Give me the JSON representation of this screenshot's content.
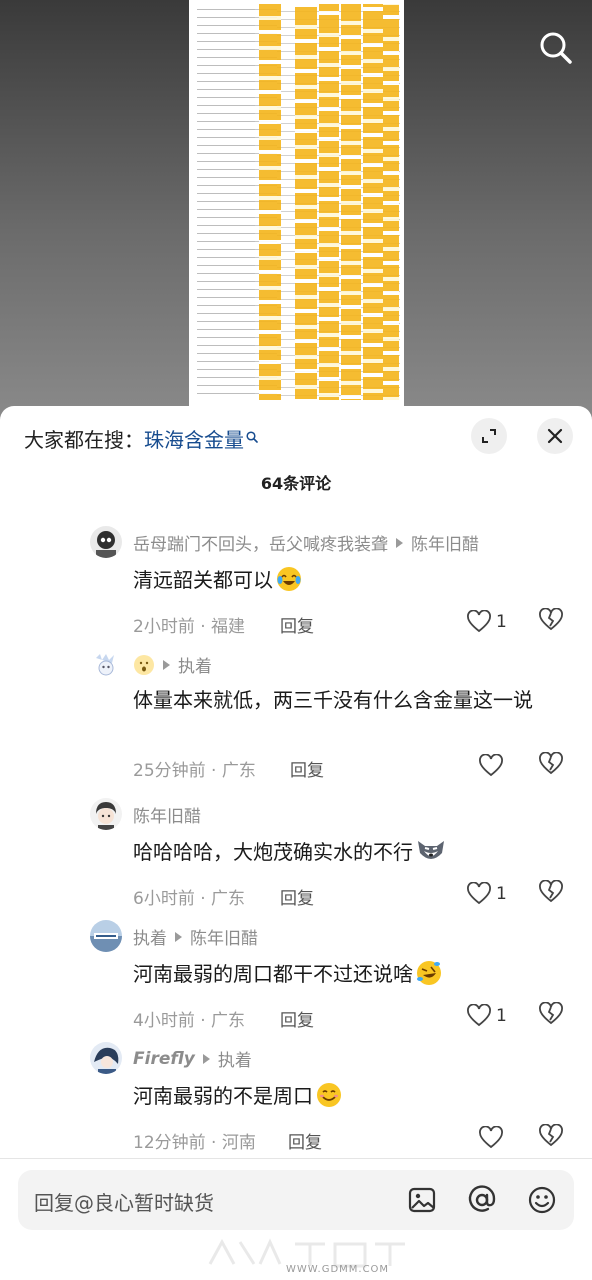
{
  "header": {
    "search_prompt_label": "大家都在搜：",
    "search_keyword": "珠海含金量",
    "comment_count": "64条评论"
  },
  "icons": {
    "top_search": "search-icon",
    "expand": "expand-icon",
    "close": "close-icon",
    "like": "heart-outline-icon",
    "dislike": "broken-heart-icon",
    "image": "image-icon",
    "at": "at-icon",
    "emoji": "emoji-icon"
  },
  "comments": [
    {
      "user": "岳母踹门不回头，岳父喊疼我装聋",
      "reply_to": "陈年旧醋",
      "text": "清远韶关都可以",
      "emoji": "laughing-crying-emoji",
      "time_location": "2小时前 · 福建",
      "reply_label": "回复",
      "likes": "1"
    },
    {
      "user_emoji": "surprised-face-emoji",
      "reply_to": "执着",
      "text": "体量本来就低，两三千没有什么含金量这一说",
      "time_location": "25分钟前 · 广东",
      "reply_label": "回复",
      "likes": ""
    },
    {
      "user": "陈年旧醋",
      "text": "哈哈哈哈，大炮茂确实水的不行",
      "emoji": "husky-dog-emoji",
      "time_location": "6小时前 · 广东",
      "reply_label": "回复",
      "likes": "1"
    },
    {
      "user": "执着",
      "reply_to": "陈年旧醋",
      "text": "河南最弱的周口都干不过还说啥",
      "emoji": "rolling-laughing-emoji",
      "time_location": "4小时前 · 广东",
      "reply_label": "回复",
      "likes": "1"
    },
    {
      "user": "Firefly",
      "reply_to": "执着",
      "text": "河南最弱的不是周口",
      "emoji": "smiling-face-emoji",
      "time_location": "12分钟前 · 河南",
      "reply_label": "回复",
      "likes": ""
    }
  ],
  "input_bar": {
    "placeholder": "回复@良心暂时缺货"
  },
  "watermark": {
    "text": "WWW.GDMM.COM"
  },
  "colors": {
    "keyword": "#174c8f",
    "highlight_yellow": "#f4b41a",
    "background_dark": "#2b2b2b"
  }
}
